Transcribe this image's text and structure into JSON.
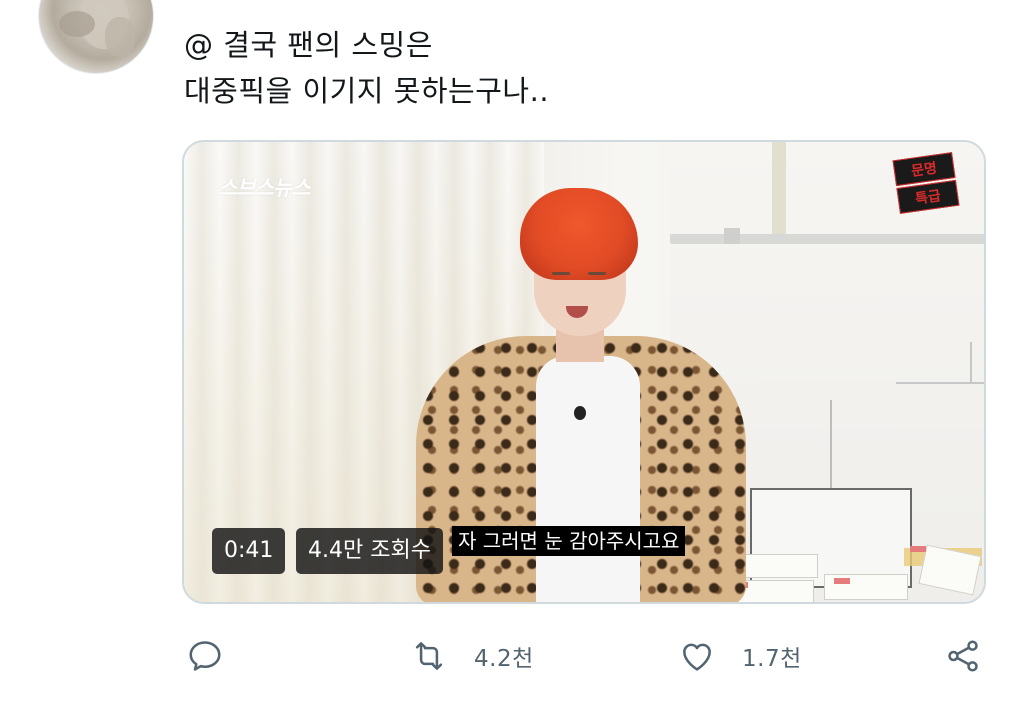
{
  "tweet": {
    "text_lines": [
      "@ 결국 팬의 스밍은",
      "대중픽을 이기지 못하는구나.."
    ]
  },
  "media": {
    "logo_left": "스브스뉴스",
    "logo_right": [
      "문명",
      "특급"
    ],
    "subtitle": "자 그러면 눈 감아주시고요",
    "duration": "0:41",
    "views": "4.4만 조회수"
  },
  "actions": {
    "reply_icon": "reply-icon",
    "retweet_icon": "retweet-icon",
    "retweet_count": "4.2천",
    "like_icon": "heart-icon",
    "like_count": "1.7천",
    "share_icon": "share-icon"
  },
  "colors": {
    "text": "#14171a",
    "secondary": "#536471",
    "border": "#cfd9de"
  }
}
